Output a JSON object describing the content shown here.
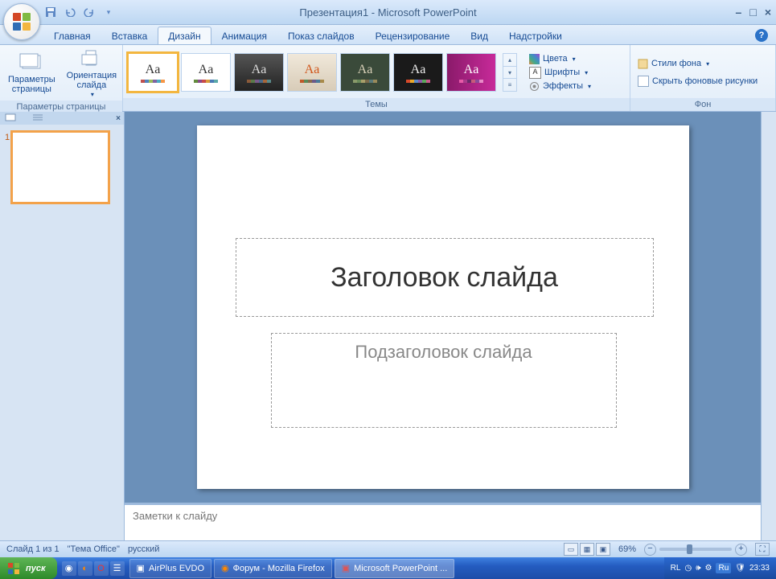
{
  "title": "Презентация1 - Microsoft PowerPoint",
  "tabs": {
    "home": "Главная",
    "insert": "Вставка",
    "design": "Дизайн",
    "animation": "Анимация",
    "slideshow": "Показ слайдов",
    "review": "Рецензирование",
    "view": "Вид",
    "addins": "Надстройки"
  },
  "ribbon": {
    "page_setup": {
      "params": "Параметры\nстраницы",
      "orient": "Ориентация\nслайда",
      "label": "Параметры страницы"
    },
    "themes_label": "Темы",
    "colors": "Цвета",
    "fonts": "Шрифты",
    "effects": "Эффекты",
    "bg_styles": "Стили фона",
    "hide_bg": "Скрыть фоновые рисунки",
    "bg_label": "Фон"
  },
  "slide": {
    "title": "Заголовок слайда",
    "subtitle": "Подзаголовок слайда"
  },
  "notes": "Заметки к слайду",
  "status": {
    "slide": "Слайд 1 из 1",
    "theme": "\"Тема Office\"",
    "lang": "русский",
    "zoom": "69%"
  },
  "taskbar": {
    "start": "пуск",
    "t1": "AirPlus EVDO",
    "t2": "Форум - Mozilla Firefox",
    "t3": "Microsoft PowerPoint ...",
    "lang": "RL",
    "lang2": "Ru",
    "time": "23:33"
  }
}
